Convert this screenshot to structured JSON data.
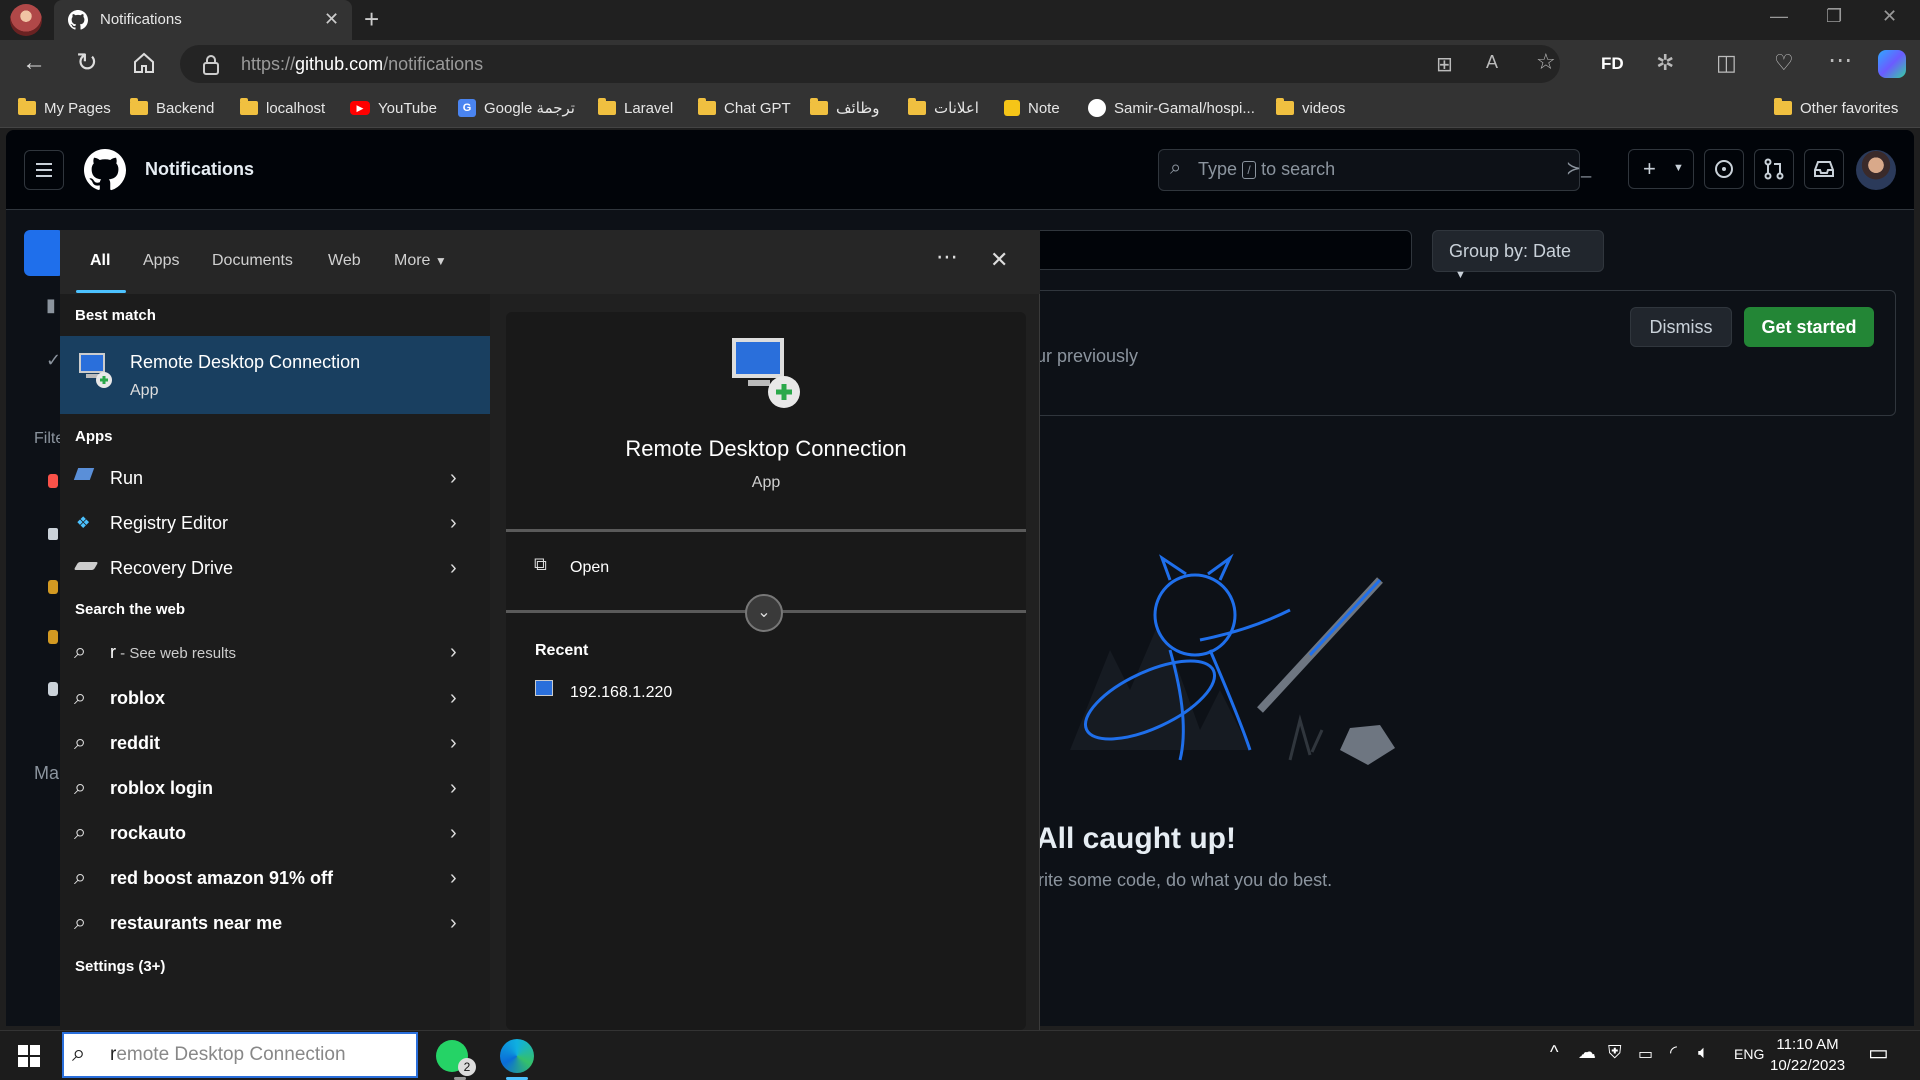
{
  "browser": {
    "tab_title": "Notifications",
    "url_prefix": "https://",
    "url_host": "github.com",
    "url_path": "/notifications",
    "profile_badge": "FD"
  },
  "bookmarks": [
    {
      "label": "My Pages",
      "icon": "folder-icon"
    },
    {
      "label": "Backend",
      "icon": "folder-icon"
    },
    {
      "label": "localhost",
      "icon": "folder-icon"
    },
    {
      "label": "YouTube",
      "icon": "youtube-icon"
    },
    {
      "label": "Google ترجمة",
      "icon": "google-translate-icon"
    },
    {
      "label": "Laravel",
      "icon": "folder-icon"
    },
    {
      "label": "Chat GPT",
      "icon": "folder-icon"
    },
    {
      "label": "وظائف",
      "icon": "folder-icon"
    },
    {
      "label": "اعلانات",
      "icon": "folder-icon"
    },
    {
      "label": "Note",
      "icon": "note-icon"
    },
    {
      "label": "Samir-Gamal/hospi...",
      "icon": "github-icon"
    },
    {
      "label": "videos",
      "icon": "folder-icon"
    },
    {
      "label": "Other favorites",
      "icon": "folder-icon"
    }
  ],
  "github": {
    "page_title": "Notifications",
    "search_prefix": "Type",
    "search_key": "/",
    "search_suffix": "to search",
    "group_by": "Group by: Date",
    "dismiss": "Dismiss",
    "get_started": "Get started",
    "banner_text": "ur previously",
    "sidebar_filter": "Filte",
    "sidebar_manage": "Ma",
    "caught_up": "All caught up!",
    "caught_up_sub": "rite some code, do what you do best."
  },
  "start_menu": {
    "tabs": [
      "All",
      "Apps",
      "Documents",
      "Web",
      "More"
    ],
    "best_match_header": "Best match",
    "best_match": {
      "name": "Remote Desktop Connection",
      "type": "App"
    },
    "apps_header": "Apps",
    "apps": [
      "Run",
      "Registry Editor",
      "Recovery Drive"
    ],
    "web_header": "Search the web",
    "web_first_query": "r",
    "web_first_suffix": " - See web results",
    "web_results": [
      "roblox",
      "reddit",
      "roblox login",
      "rockauto",
      "red boost amazon 91% off",
      "restaurants near me"
    ],
    "settings_header": "Settings (3+)",
    "detail": {
      "name": "Remote Desktop Connection",
      "type": "App",
      "open_label": "Open",
      "recent_header": "Recent",
      "recent_items": [
        "192.168.1.220"
      ]
    }
  },
  "taskbar": {
    "search_text": "remote Desktop Connection",
    "whatsapp_badge": "2",
    "language": "ENG",
    "time": "11:10 AM",
    "date": "10/22/2023"
  },
  "colors": {
    "accent": "#4cc2ff",
    "selection": "#193f60",
    "github_green": "#238636",
    "github_bg": "#0d1117"
  }
}
